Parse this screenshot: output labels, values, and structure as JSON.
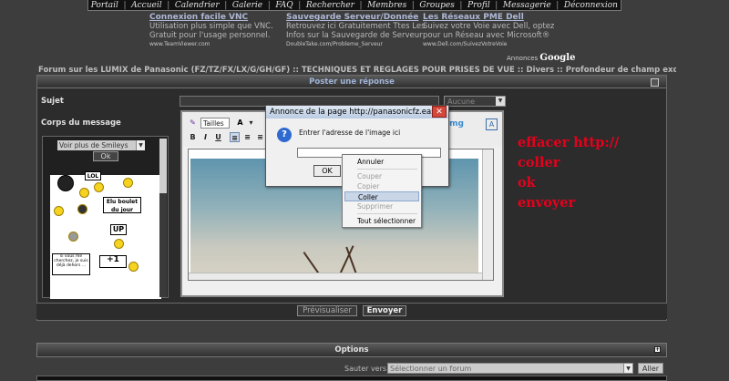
{
  "nav": {
    "items": [
      "Portail",
      "Accueil",
      "Calendrier",
      "Galerie",
      "FAQ",
      "Rechercher",
      "Membres",
      "Groupes",
      "Profil",
      "Messagerie",
      "Déconnexion"
    ]
  },
  "ads": {
    "items": [
      {
        "title": "Connexion facile VNC",
        "line1": "Utilisation plus simple que VNC.",
        "line2": "Gratuit pour l'usage personnel.",
        "url": "www.TeamViewer.com"
      },
      {
        "title": "Sauvegarde Serveur/Donnée",
        "line1": "Retrouvez ici Gratuitement Ttes Les",
        "line2": "Infos sur la Sauvegarde de Serveur",
        "url": "DoubleTake.com/Probleme_Serveur"
      },
      {
        "title": "Les Réseaux PME Dell",
        "line1": "Suivez votre Voie avec Dell, optez",
        "line2": "pour un Réseau avec Microsoft®",
        "url": "www.Dell.com/SuivezVotreVoie"
      }
    ],
    "by": "Annonces",
    "brand": "Google"
  },
  "breadcrumb": "Forum sur les LUMIX de Panasonic (FZ/TZ/FX/LX/G/GH/GF) :: TECHNIQUES ET REGLAGES POUR PRISES DE VUE :: Divers :: Profondeur de champ exceptionnelle",
  "post": {
    "header": "Poster une réponse",
    "subject_label": "Sujet",
    "subject_value": "",
    "icon_select": "Aucune",
    "body_label": "Corps du message"
  },
  "smileys": {
    "select": "Voir plus de Smileys",
    "ok": "Ok",
    "signs": [
      "LOL",
      "Elu boulet du jour",
      "UP",
      "si vous me cherchez, je suis déjà dehors ...",
      "+1"
    ]
  },
  "editor": {
    "size_select": "Tailles",
    "toolbar": {
      "bold": "B",
      "italic": "I",
      "underline": "U",
      "img": "img"
    }
  },
  "dialog": {
    "title": "Annonce de la page http://panasonicfz.easy...",
    "message": "Entrer l'adresse de l'image ici",
    "input_value": "",
    "ok": "OK"
  },
  "context_menu": {
    "items": [
      {
        "label": "Annuler",
        "enabled": true
      },
      {
        "label": "Couper",
        "enabled": false
      },
      {
        "label": "Copier",
        "enabled": false
      },
      {
        "label": "Coller",
        "enabled": true,
        "highlighted": true
      },
      {
        "label": "Supprimer",
        "enabled": false
      },
      {
        "label": "Tout sélectionner",
        "enabled": true
      }
    ]
  },
  "annotation": {
    "lines": [
      "effacer http://",
      "coller",
      "ok",
      "envoyer"
    ],
    "color": "#e6001c"
  },
  "buttons": {
    "preview": "Prévisualiser",
    "send": "Envoyer"
  },
  "options": {
    "header": "Options"
  },
  "jump": {
    "label": "Sauter vers:",
    "select": "Sélectionner un forum",
    "go": "Aller"
  }
}
